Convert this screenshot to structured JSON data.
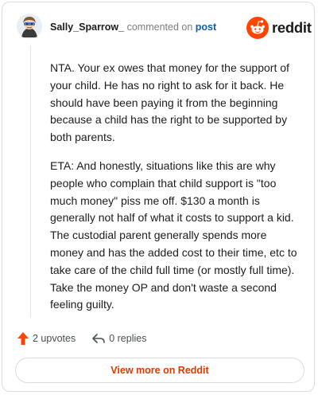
{
  "header": {
    "username": "Sally_Sparrow_",
    "action_text": "commented on",
    "post_link": "post",
    "logo_text": "reddit"
  },
  "comment": {
    "paragraphs": [
      "NTA. Your ex owes that money for the support of your child. He has no right to ask for it back. He should have been paying it from the beginning because a child has the right to be supported by both parents.",
      "ETA: And honestly, situations like this are why people who complain that child support is \"too much money\" piss me off. $130 a month is generally not half of what it costs to support a kid. The custodial parent generally spends more money and has the added cost to their time, etc to take care of the child full time (or mostly full time). Take the money OP and don't waste a second feeling guilty."
    ]
  },
  "actions": {
    "upvotes": "2 upvotes",
    "replies": "0 replies"
  },
  "footer": {
    "view_more": "View more on Reddit"
  },
  "colors": {
    "brand": "#ff4500",
    "link": "#0f5ea8",
    "view_more": "#d93a00"
  }
}
